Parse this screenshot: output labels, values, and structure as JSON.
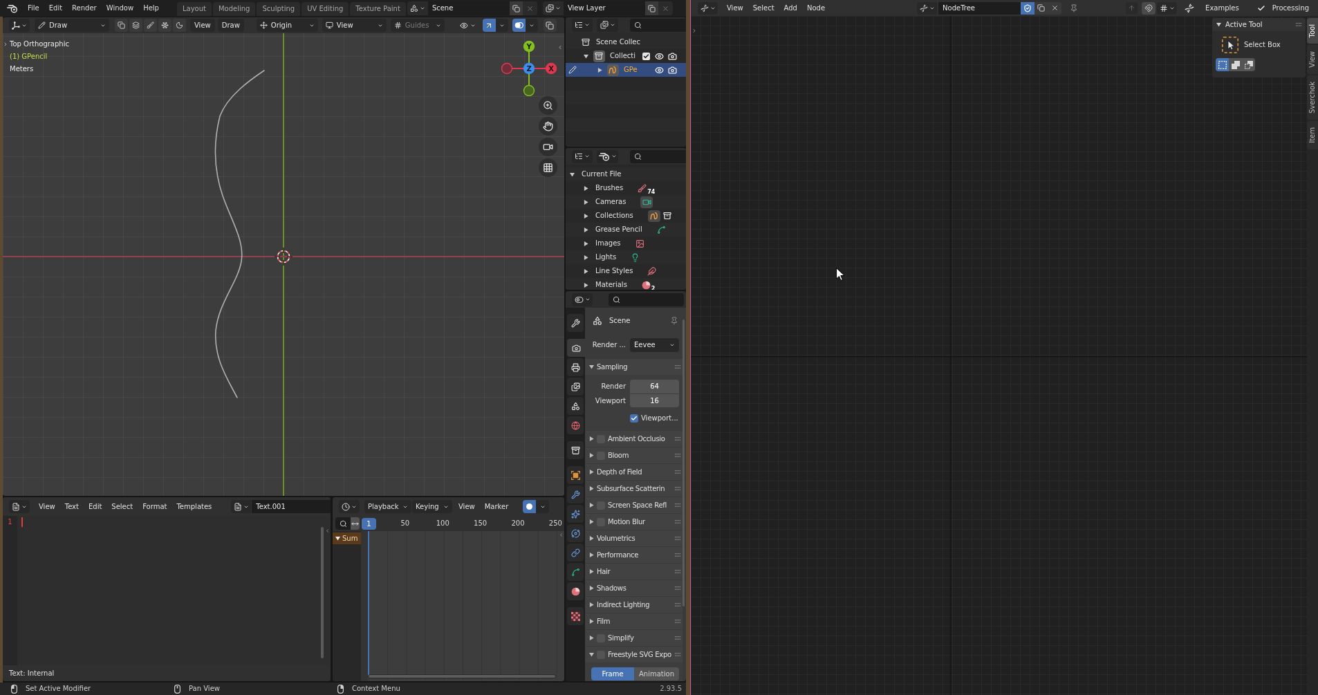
{
  "topbar": {
    "menus": [
      "File",
      "Edit",
      "Render",
      "Window",
      "Help"
    ],
    "workspaces": [
      {
        "label": "Layout",
        "selected": false
      },
      {
        "label": "Modeling",
        "selected": false
      },
      {
        "label": "Sculpting",
        "selected": false
      },
      {
        "label": "UV Editing",
        "selected": false
      },
      {
        "label": "Texture Paint",
        "selected": false
      }
    ],
    "scene": "Scene",
    "view_layer": "View Layer"
  },
  "viewport": {
    "header": {
      "mode": "Draw",
      "menus": [
        "View",
        "Draw"
      ],
      "pivot": "Origin",
      "orientation": "View",
      "guides": {
        "label": "Guides",
        "on": false
      },
      "toggles": [
        {
          "kind": "gizmos",
          "on": true
        },
        {
          "kind": "overlays",
          "on": true
        },
        {
          "kind": "xray",
          "on": false
        }
      ]
    },
    "info": [
      {
        "text": "Top Orthographic",
        "kind": "view"
      },
      {
        "text": "(1) GPencil",
        "kind": "object"
      },
      {
        "text": "Meters",
        "kind": "view"
      }
    ],
    "gizmo": [
      {
        "kind": "up",
        "label": "Y",
        "color": "#82c01e"
      },
      {
        "kind": "left",
        "color": "#e2374f"
      },
      {
        "kind": "center",
        "label": "Z",
        "color": "#3b8ff0"
      },
      {
        "kind": "right",
        "label": "X",
        "color": "#e2374f"
      },
      {
        "kind": "down",
        "color": "#82c01e"
      }
    ]
  },
  "outliner": {
    "tree": {
      "label": "Scene Collec",
      "kind": "scene_collection",
      "active": false,
      "selected": false,
      "children": [
        {
          "label": "Collecti",
          "kind": "collection",
          "expanded": true,
          "checked": true,
          "visible": true,
          "renderable": true,
          "active": true,
          "selected": false,
          "children": [
            {
              "label": "GPe",
              "kind": "gpencil",
              "expanded": false,
              "visible": true,
              "renderable": true,
              "active": true,
              "selected": true
            }
          ]
        }
      ]
    }
  },
  "file_outliner": {
    "root": {
      "label": "Current File",
      "expanded": true,
      "children": [
        {
          "label": "Brushes",
          "kind": "brushes",
          "expanded": false,
          "count": "74"
        },
        {
          "label": "Cameras",
          "kind": "cameras",
          "expanded": false
        },
        {
          "label": "Collections",
          "kind": "collections",
          "expanded": false
        },
        {
          "label": "Grease Pencil",
          "kind": "grease_pencil",
          "expanded": false
        },
        {
          "label": "Images",
          "kind": "images",
          "expanded": false
        },
        {
          "label": "Lights",
          "kind": "lights",
          "expanded": false
        },
        {
          "label": "Line Styles",
          "kind": "line_styles",
          "expanded": false
        },
        {
          "label": "Materials",
          "kind": "materials",
          "expanded": false,
          "count": "2"
        }
      ]
    }
  },
  "properties": {
    "tab_groups": [
      [
        {
          "kind": "tool",
          "selected": false
        }
      ],
      [
        {
          "kind": "render",
          "selected": true
        },
        {
          "kind": "output",
          "selected": false
        },
        {
          "kind": "view_layer",
          "selected": false
        },
        {
          "kind": "scene",
          "selected": false
        },
        {
          "kind": "world",
          "selected": false
        }
      ],
      [
        {
          "kind": "collection",
          "selected": false
        }
      ],
      [
        {
          "kind": "object",
          "selected": false
        },
        {
          "kind": "modifiers",
          "selected": false
        },
        {
          "kind": "particles",
          "selected": false
        },
        {
          "kind": "physics",
          "selected": false
        },
        {
          "kind": "constraints",
          "selected": false
        },
        {
          "kind": "data",
          "selected": false
        },
        {
          "kind": "material",
          "selected": false
        }
      ],
      [
        {
          "kind": "texture",
          "selected": false
        }
      ]
    ],
    "context": "Scene",
    "render_engine": {
      "label": "Render ...",
      "value": "Eevee"
    },
    "panels": [
      {
        "title": "Sampling",
        "kind": "plain",
        "expanded": true,
        "fields": [
          {
            "label": "Render",
            "value": "64"
          },
          {
            "label": "Viewport",
            "value": "16"
          }
        ],
        "option": {
          "label": "Viewport...",
          "checked": true
        }
      },
      {
        "title": "Ambient Occlusio",
        "kind": "toggle",
        "checked": false,
        "expanded": false
      },
      {
        "title": "Bloom",
        "kind": "toggle",
        "checked": false,
        "expanded": false
      },
      {
        "title": "Depth of Field",
        "kind": "plain",
        "expanded": false
      },
      {
        "title": "Subsurface Scatterin",
        "kind": "plain",
        "expanded": false
      },
      {
        "title": "Screen Space Refl",
        "kind": "toggle",
        "checked": false,
        "expanded": false
      },
      {
        "title": "Motion Blur",
        "kind": "toggle",
        "checked": false,
        "expanded": false
      },
      {
        "title": "Volumetrics",
        "kind": "plain",
        "expanded": false
      },
      {
        "title": "Performance",
        "kind": "plain",
        "expanded": false
      },
      {
        "title": "Hair",
        "kind": "plain",
        "expanded": false
      },
      {
        "title": "Shadows",
        "kind": "plain",
        "expanded": false
      },
      {
        "title": "Indirect Lighting",
        "kind": "plain",
        "expanded": false
      },
      {
        "title": "Film",
        "kind": "plain",
        "expanded": false
      },
      {
        "title": "Simplify",
        "kind": "toggle",
        "checked": false,
        "expanded": false
      },
      {
        "title": "Freestyle SVG Expo",
        "kind": "toggle",
        "checked": false,
        "expanded": true,
        "modes": [
          {
            "label": "Frame",
            "selected": true
          },
          {
            "label": "Animation",
            "selected": false
          }
        ]
      }
    ]
  },
  "text_editor": {
    "menus": [
      "View",
      "Text",
      "Edit",
      "Select",
      "Format",
      "Templates"
    ],
    "text_name": "Text.001",
    "line_numbers": [
      "1"
    ],
    "footer": "Text: Internal"
  },
  "timeline": {
    "dropdowns": [
      "Playback",
      "Keying"
    ],
    "menus": [
      "View",
      "Marker"
    ],
    "auto_keying": {
      "on": true
    },
    "current_frame": "1",
    "frame_labels": [
      "50",
      "100",
      "150",
      "200",
      "250"
    ],
    "channels": [
      {
        "label": "Sum",
        "expanded": true
      }
    ]
  },
  "status_bar": {
    "hints": [
      {
        "kind": "left",
        "text": "Set Active Modifier"
      },
      {
        "kind": "middle",
        "text": "Pan View"
      },
      {
        "kind": "right",
        "text": "Context Menu"
      }
    ],
    "version": "2.93.5"
  },
  "node_editor": {
    "menus": [
      "View",
      "Select",
      "Add",
      "Node"
    ],
    "node_tree": {
      "name": "NodeTree",
      "fake_user": true
    },
    "examples_menu": "Examples",
    "processing": {
      "label": "Processing",
      "checked": true
    },
    "sidebar": {
      "tabs": [
        {
          "label": "Tool",
          "selected": true
        },
        {
          "label": "View",
          "selected": false
        },
        {
          "label": "Sverchok",
          "selected": false
        },
        {
          "label": "Item",
          "selected": false
        }
      ],
      "panel": {
        "title": "Active Tool",
        "expanded": true,
        "tool": "Select Box",
        "modes": [
          {
            "kind": "set",
            "selected": true
          },
          {
            "kind": "extend",
            "selected": false
          },
          {
            "kind": "subtract",
            "selected": false
          }
        ]
      }
    }
  }
}
